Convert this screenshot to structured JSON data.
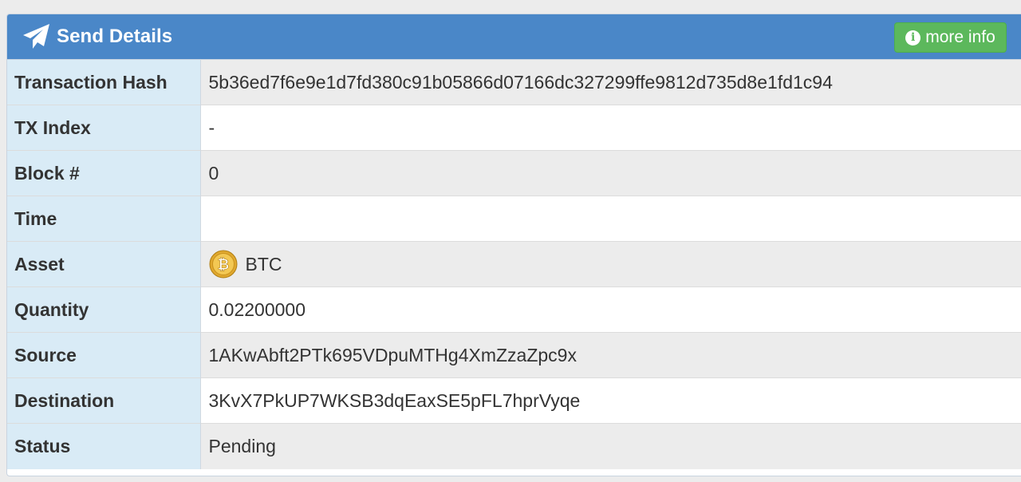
{
  "panel": {
    "title": "Send Details",
    "title_icon": "paper-plane-icon",
    "more_info_label": "more info",
    "more_info_icon": "info-circle-icon"
  },
  "rows": [
    {
      "label": "Transaction Hash",
      "value": "5b36ed7f6e9e1d7fd380c91b05866d07166dc327299ffe9812d735d8e1fd1c94"
    },
    {
      "label": "TX Index",
      "value": "-"
    },
    {
      "label": "Block #",
      "value": "0"
    },
    {
      "label": "Time",
      "value": ""
    },
    {
      "label": "Asset",
      "value": "BTC",
      "icon": "bitcoin-coin-icon"
    },
    {
      "label": "Quantity",
      "value": "0.02200000"
    },
    {
      "label": "Source",
      "value": "1AKwAbft2PTk695VDpuMTHg4XmZzaZpc9x"
    },
    {
      "label": "Destination",
      "value": "3KvX7PkUP7WKSB3dqEaxSE5pFL7hprVyqe"
    },
    {
      "label": "Status",
      "value": "Pending"
    }
  ],
  "colors": {
    "header": "#4a87c8",
    "button": "#5cb85c",
    "label_bg": "#d9ebf6",
    "stripe": "#ececec"
  }
}
